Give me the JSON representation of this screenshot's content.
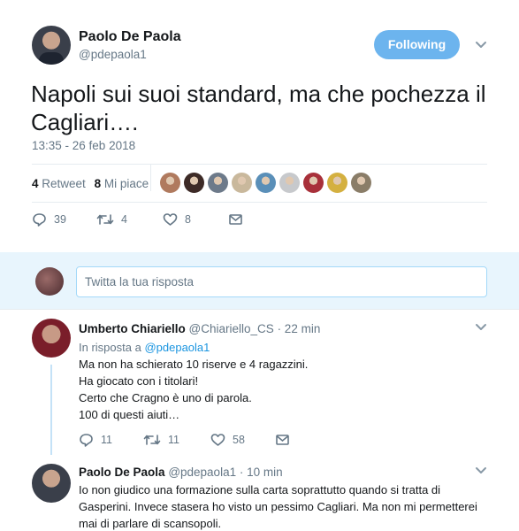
{
  "tweet": {
    "author_name": "Paolo De Paola",
    "author_handle": "@pdepaola1",
    "follow_label": "Following",
    "text": "Napoli sui suoi standard, ma che pochezza il Cagliari….",
    "timestamp": "13:35 - 26 feb 2018",
    "retweets_count": "4",
    "retweets_label": "Retweet",
    "likes_count": "8",
    "likes_label": "Mi piace",
    "actions": {
      "replies": "39",
      "retweets": "4",
      "likes": "8"
    },
    "likers": [
      {
        "color": "#b07a5e"
      },
      {
        "color": "#3d2a26"
      },
      {
        "color": "#6d7a8a"
      },
      {
        "color": "#c9b89c"
      },
      {
        "color": "#5a8fb8"
      },
      {
        "color": "#c7c9cc"
      },
      {
        "color": "#a8303a"
      },
      {
        "color": "#d4b040"
      },
      {
        "color": "#8a7d68"
      }
    ]
  },
  "reply_box": {
    "placeholder": "Twitta la tua risposta"
  },
  "replies": [
    {
      "name": "Umberto Chiariello",
      "handle": "@Chiariello_CS",
      "time": "· 22 min",
      "in_reply_prefix": "In risposta a",
      "in_reply_to": "@pdepaola1",
      "lines": [
        "Ma non ha schierato 10 riserve e 4 ragazzini.",
        "Ha giocato con i titolari!",
        "Certo che Cragno è uno di parola.",
        "100 di questi aiuti…"
      ],
      "actions": {
        "replies": "11",
        "retweets": "11",
        "likes": "58"
      }
    },
    {
      "name": "Paolo De Paola",
      "handle": "@pdepaola1",
      "time": "· 10 min",
      "lines": [
        "Io non giudico una formazione sulla carta soprattutto quando si tratta di",
        "Gasperini. Invece stasera ho visto un pessimo Cagliari. Ma non mi permetterei",
        "mai di parlare di scansopoli."
      ]
    }
  ],
  "colors": {
    "accent": "#1da1f2",
    "follow_bg": "#6cb4ee",
    "reply_bg": "#e8f5fd",
    "muted": "#657786"
  }
}
